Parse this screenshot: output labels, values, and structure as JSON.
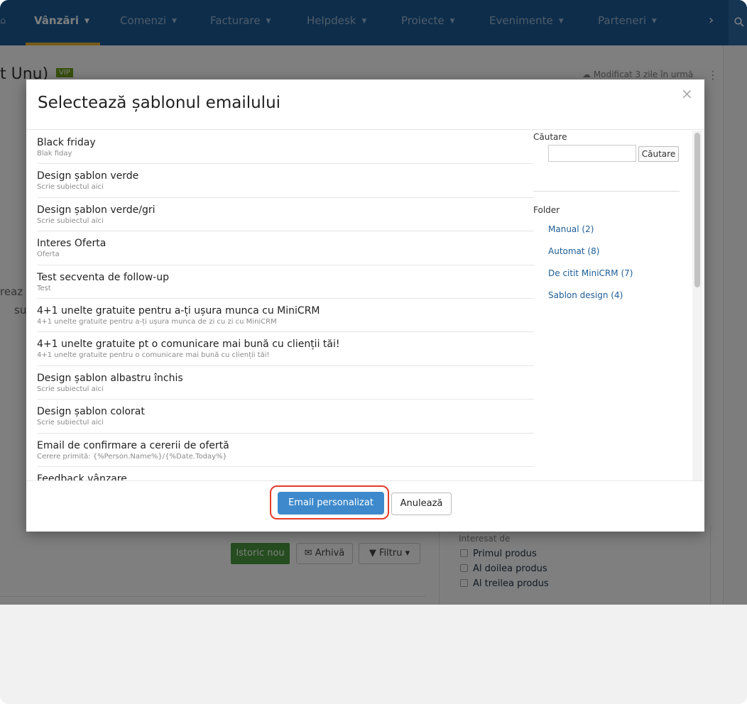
{
  "nav": {
    "items": [
      {
        "label": "Vânzări",
        "active": true
      },
      {
        "label": "Comenzi"
      },
      {
        "label": "Facturare"
      },
      {
        "label": "Helpdesk"
      },
      {
        "label": "Proiecte"
      },
      {
        "label": "Evenimente"
      },
      {
        "label": "Parteneri"
      }
    ],
    "more_glyph": "›"
  },
  "background": {
    "title": "t Unu)",
    "vip_badge": "VIP",
    "modified": "Modificat 3 zile în urmă",
    "partial_text_1": "reaz",
    "partial_text_2": "su",
    "istoric_button": "Istoric nou",
    "arhiva_button": "Arhivă",
    "filtru_button": "Filtru",
    "interesat_label": "Interesat de",
    "checkboxes": [
      "Primul produs",
      "Al doilea produs",
      "Al treilea produs"
    ]
  },
  "modal": {
    "title": "Selectează șablonul emailului",
    "close_glyph": "×",
    "templates": [
      {
        "name": "Black friday",
        "subject": "Blak fiday"
      },
      {
        "name": "Design șablon verde",
        "subject": "Scrie subiectul aici"
      },
      {
        "name": "Design șablon verde/gri",
        "subject": "Scrie subiectul aici"
      },
      {
        "name": "Interes Oferta",
        "subject": "Oferta"
      },
      {
        "name": "Test secventa de follow-up",
        "subject": "Test"
      },
      {
        "name": "4+1 unelte gratuite pentru a-ți ușura munca cu MiniCRM",
        "subject": "4+1 unelte gratuite pentru a-ți ușura munca de zi cu zi cu MiniCRM"
      },
      {
        "name": "4+1 unelte gratuite pt o comunicare mai bună cu clienții tăi!",
        "subject": "4+1 unelte gratuite pentru o comunicare mai bună cu clienții tăi!"
      },
      {
        "name": "Design șablon albastru închis",
        "subject": "Scrie subiectul aici"
      },
      {
        "name": "Design șablon colorat",
        "subject": "Scrie subiectul aici"
      },
      {
        "name": "Email de confirmare a cererii de ofertă",
        "subject": "Cerere primită: {%Person.Name%}/{%Date.Today%}"
      },
      {
        "name": "Feedback vânzare",
        "subject": ""
      }
    ],
    "search": {
      "label": "Căutare",
      "value": "",
      "button": "Căutare"
    },
    "folder": {
      "label": "Folder",
      "items": [
        "Manual (2)",
        "Automat (8)",
        "De citit MiniCRM (7)",
        "Sablon design (4)"
      ]
    },
    "buttons": {
      "primary": "Email personalizat",
      "cancel": "Anulează"
    }
  }
}
